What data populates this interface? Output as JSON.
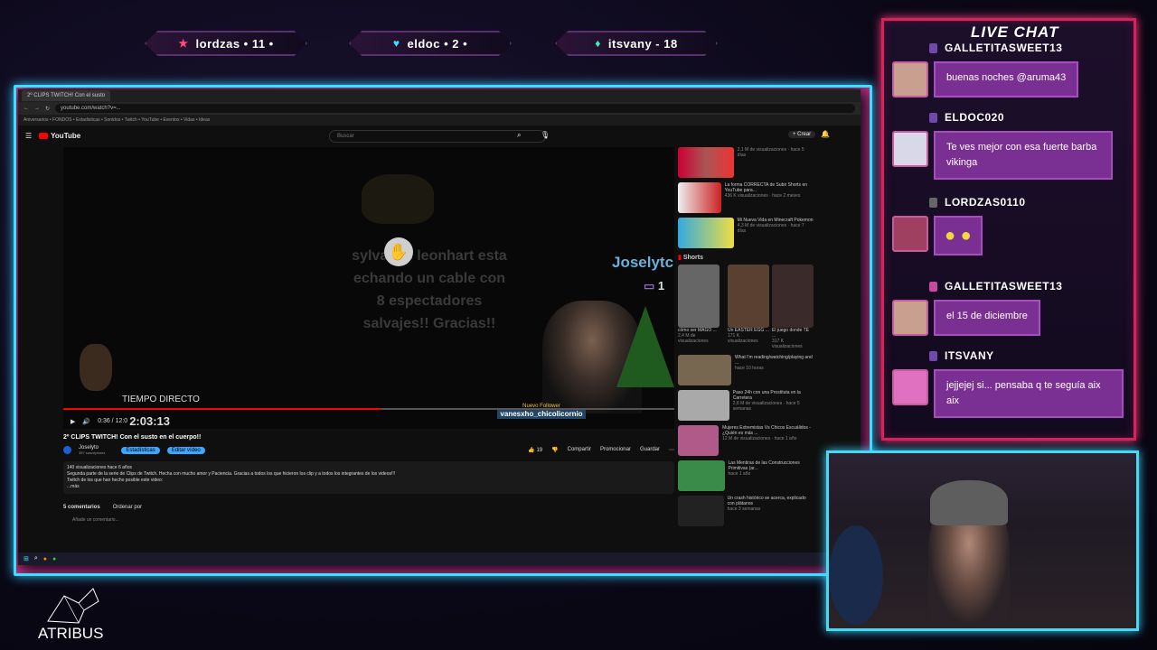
{
  "banners": [
    {
      "icon": "star-icon",
      "text": "lordzas • 11 •"
    },
    {
      "icon": "heart-icon",
      "text": "eldoc • 2 •"
    },
    {
      "icon": "drop-icon",
      "text": "itsvany - 18"
    }
  ],
  "browser": {
    "tab_title": "2º CLIPS TWITCH! Con el susto",
    "url": "youtube.com/watch?v=...",
    "bookmarks": "Aniversarios  •  FONDOS  •  Estadisticas  •  Sonidos  •  Twitch  •  YouTube  •  Eventos  •  Vidas  •  Ideas",
    "yt_brand": "YouTube",
    "search_placeholder": "Buscar",
    "create_label": "+ Crear"
  },
  "video": {
    "overlay_lines": [
      "sylvanas leonhart esta",
      "echando un cable con",
      "8 espectadores",
      "salvajes!! Gracias!!"
    ],
    "streamer_label": "Joselytc",
    "chat_count": "1",
    "live_label": "TIEMPO DIRECTO",
    "elapsed": "0:36 / 12:0",
    "stream_time": "2:03:13",
    "new_follower_label": "Nuevo Follower",
    "new_follower_name": "vanesxho_chicolicornio",
    "title": "2º CLIPS TWITCH! Con el susto en el cuerpo!!",
    "channel": "Joselyto",
    "subs": "357 suscriptores",
    "btn_stats": "Estadísticas",
    "btn_edit": "Editar vídeo",
    "likes": "19",
    "btn_share": "Compartir",
    "btn_promote": "Promocionar",
    "btn_save": "Guardar",
    "desc_line1": "140 visualizaciones  hace 6 años",
    "desc_line2": "Segunda parte de la serie de Clips de Twitch. Hecha con mucho amor y Paciencia. Gracias a todos los que hicieron los clip y a todos los integrantes de los videos!!!",
    "desc_line3": "Twitch de los que han hecho posible este video:",
    "desc_more": "...más",
    "comments_count": "5 comentarios",
    "sort_label": "Ordenar por",
    "add_comment": "Añade un comentario..."
  },
  "sidebar": {
    "videos": [
      {
        "title": "",
        "meta": "2,1 M de visualizaciones · hace 5 días"
      },
      {
        "title": "La forma CORRECTA de Subir Shorts en YouTube para...",
        "meta": "436 K visualizaciones · hace 2 meses"
      },
      {
        "title": "Mi Nueva Vida en Minecraft Pokemon",
        "meta": "4,3 M de visualizaciones · hace 7 días"
      }
    ],
    "shorts_label": "Shorts",
    "shorts": [
      {
        "title": "cómo ser MAGO ...",
        "meta": "2,4 M de visualizaciones"
      },
      {
        "title": "Un EASTER EGG ...",
        "meta": "171 K visualizaciones"
      },
      {
        "title": "El juego donde TE ...",
        "meta": "317 K visualizaciones"
      }
    ],
    "videos2": [
      {
        "title": "What I'm reading/watching/playing and ...",
        "meta": "hace 10 horas"
      },
      {
        "title": "Paso 24h con una Prostituta en la Carretera",
        "meta": "2,8 M de visualizaciones · hace 5 semanas"
      },
      {
        "title": "Mujeres Extremistas Vs Chicos Escuálidos - ¿Quién es más ...",
        "meta": "12 M de visualizaciones · hace 1 año"
      },
      {
        "title": "Las Mentiras de las Construcciones Primitivas (ar...",
        "meta": "hace 1 año"
      },
      {
        "title": "Un crash histórico se acerca, explicado con plátanos",
        "meta": "hace 3 semanas"
      }
    ]
  },
  "chat": {
    "title": "LIVE CHAT",
    "messages": [
      {
        "user": "GALLETITASWEET13",
        "text": "buenas noches @aruma43"
      },
      {
        "user": "ELDOC020",
        "text": "Te ves mejor con esa fuerte barba vikinga"
      },
      {
        "user": "LORDZAS0110",
        "text": "(emotes)"
      },
      {
        "user": "GALLETITASWEET13",
        "text": "el 15 de diciembre"
      },
      {
        "user": "ITSVANY",
        "text": "jejjejej si... pensaba q te seguía aix aix"
      }
    ]
  },
  "brand": "ATRIBUS",
  "colors": {
    "neon_cyan": "#3be0ff",
    "neon_pink": "#d8215d",
    "bubble": "#7a2f93",
    "yt_red": "#ff0000"
  }
}
